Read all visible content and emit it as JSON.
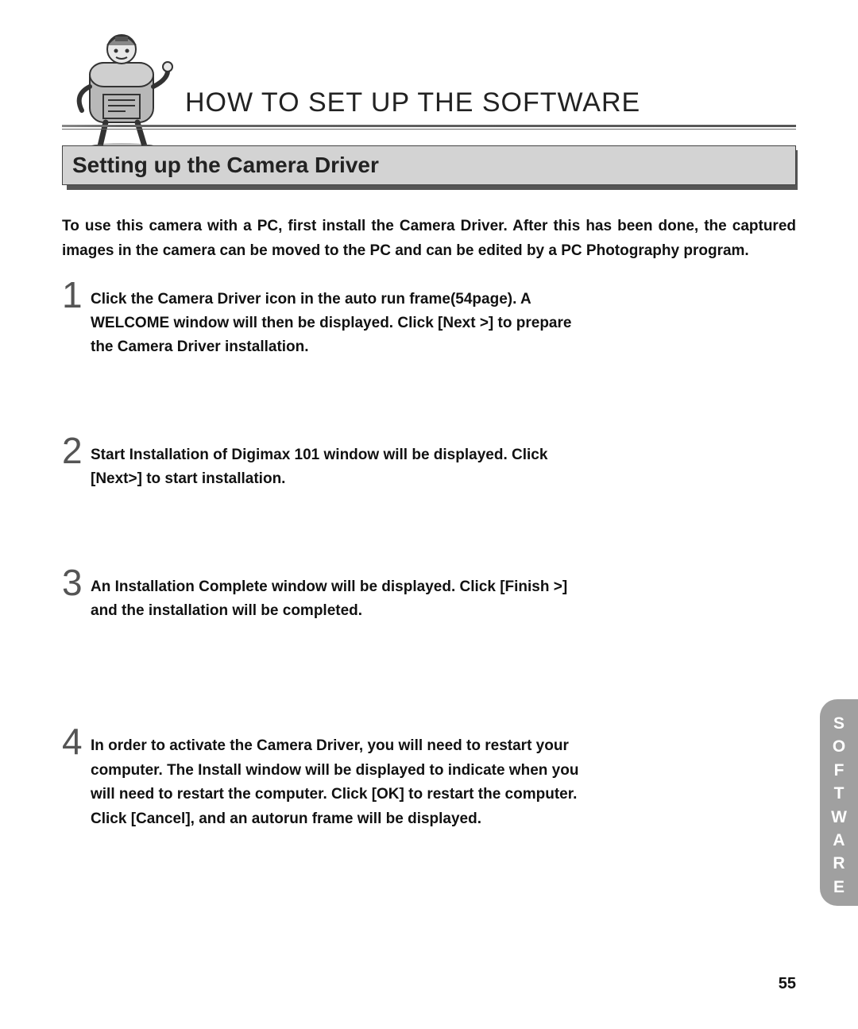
{
  "header": {
    "title": "HOW TO SET UP THE SOFTWARE"
  },
  "section": {
    "heading": "Setting up the Camera Driver"
  },
  "intro": "To use this camera with a PC, first install the Camera Driver. After this has been done, the captured images in the camera can be moved to the PC and can be edited by a PC Photography program.",
  "steps": [
    {
      "number": "1",
      "text": "Click the Camera Driver icon in the auto run frame(54page). A WELCOME window will then be displayed. Click [Next >] to prepare the Camera Driver installation."
    },
    {
      "number": "2",
      "text": "Start Installation of Digimax 101 window will be displayed. Click [Next>] to start installation."
    },
    {
      "number": "3",
      "text": "An Installation Complete window will be displayed. Click [Finish >] and the installation will be completed."
    },
    {
      "number": "4",
      "text": "In order to activate the Camera Driver, you will need to restart your computer. The Install window will be displayed to indicate when you will need to restart the computer. Click [OK] to restart the computer. Click [Cancel], and an autorun frame will be displayed."
    }
  ],
  "side_tab": [
    "S",
    "O",
    "F",
    "T",
    "W",
    "A",
    "R",
    "E"
  ],
  "page_number": "55"
}
